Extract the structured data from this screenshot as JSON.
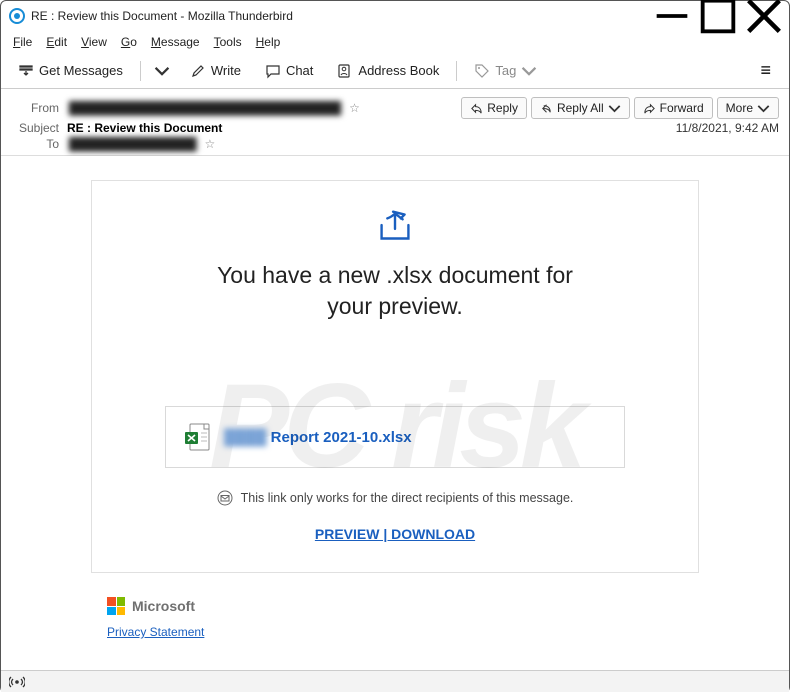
{
  "window": {
    "title": "RE : Review this Document - Mozilla Thunderbird"
  },
  "menu": {
    "file": "File",
    "edit": "Edit",
    "view": "View",
    "go": "Go",
    "message": "Message",
    "tools": "Tools",
    "help": "Help"
  },
  "toolbar": {
    "get_messages": "Get Messages",
    "write": "Write",
    "chat": "Chat",
    "address_book": "Address Book",
    "tag": "Tag"
  },
  "header": {
    "from_label": "From",
    "from_value": "████████████████████████████████",
    "subject_label": "Subject",
    "subject_value": "RE : Review this Document",
    "to_label": "To",
    "to_value": "███████████████",
    "date": "11/8/2021, 9:42 AM",
    "reply": "Reply",
    "reply_all": "Reply All",
    "forward": "Forward",
    "more": "More"
  },
  "body": {
    "headline1": "You have a new .xlsx document for",
    "headline2": "your preview.",
    "file_blur": "████",
    "file_name": " Report 2021-10.xlsx",
    "recip_text": "This link only works for the direct recipients of this message.",
    "action": "PREVIEW | DOWNLOAD",
    "ms": "Microsoft",
    "privacy": "Privacy Statement"
  }
}
